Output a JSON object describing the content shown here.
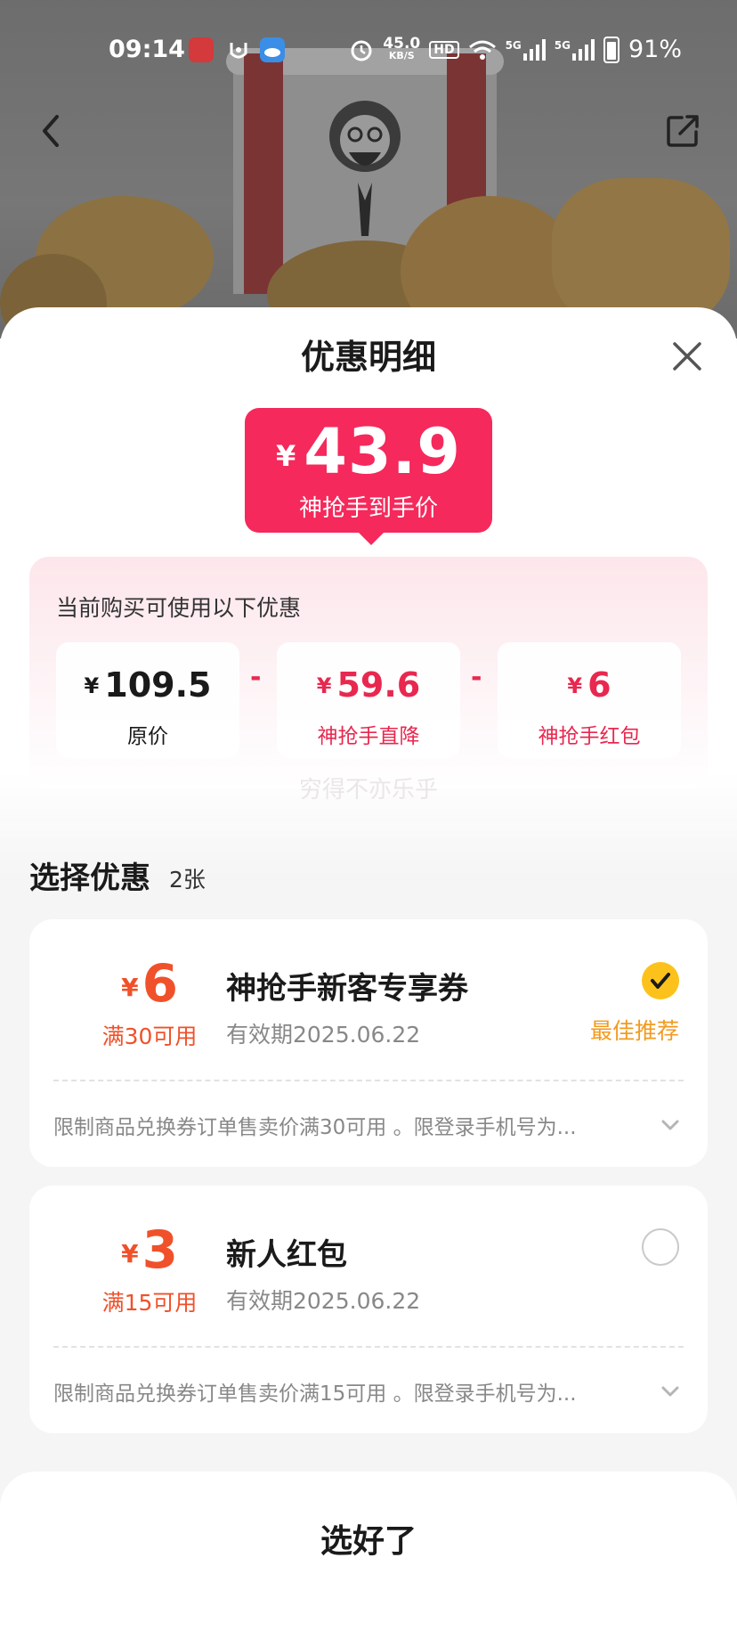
{
  "status_bar": {
    "time": "09:14",
    "network_speed": "45.0",
    "network_speed_unit": "KB/S",
    "hd_label": "HD",
    "sim1_label": "5G",
    "sim2_label": "5G",
    "battery": "91%"
  },
  "nav": {
    "back_icon": "chevron-left-icon",
    "share_icon": "share-icon"
  },
  "sheet": {
    "title": "优惠明细",
    "close_icon": "close-icon"
  },
  "final_price": {
    "currency": "¥",
    "amount": "43.9",
    "label": "神抢手到手价",
    "color": "#f5295b"
  },
  "discounts": {
    "heading": "当前购买可使用以下优惠",
    "operator": "-",
    "items": [
      {
        "currency": "¥",
        "value": "109.5",
        "label": "原价"
      },
      {
        "currency": "¥",
        "value": "59.6",
        "label": "神抢手直降"
      },
      {
        "currency": "¥",
        "value": "6",
        "label": "神抢手红包"
      }
    ],
    "watermark": "穷得不亦乐乎"
  },
  "choose": {
    "title": "选择优惠",
    "count": "2张"
  },
  "coupons": [
    {
      "currency": "¥",
      "amount": "6",
      "condition": "满30可用",
      "name": "神抢手新客专享券",
      "expiry": "有效期2025.06.22",
      "selected": true,
      "recommend": "最佳推荐",
      "description": "限制商品兑换券订单售卖价满30可用 。限登录手机号为...",
      "check_icon": "checkmark-icon",
      "expand_icon": "chevron-down-icon"
    },
    {
      "currency": "¥",
      "amount": "3",
      "condition": "满15可用",
      "name": "新人红包",
      "expiry": "有效期2025.06.22",
      "selected": false,
      "recommend": "",
      "description": "限制商品兑换券订单售卖价满15可用 。限登录手机号为...",
      "check_icon": "radio-unchecked-icon",
      "expand_icon": "chevron-down-icon"
    }
  ],
  "confirm": {
    "label": "选好了"
  },
  "colors": {
    "accent_red": "#e8284f",
    "coupon_orange": "#f0512a",
    "recommend_orange": "#f29a1f",
    "check_yellow": "#fcc21b"
  }
}
